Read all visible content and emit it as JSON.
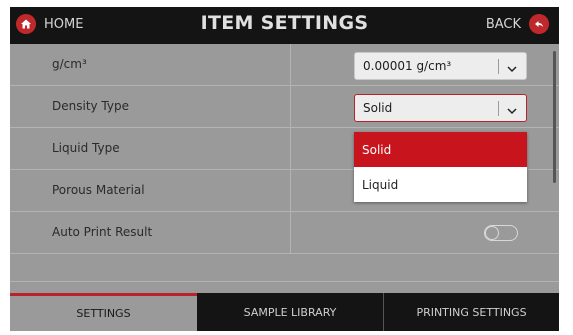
{
  "header": {
    "home_label": "HOME",
    "title": "ITEM SETTINGS",
    "back_label": "BACK"
  },
  "rows": [
    {
      "label": "g/cm³",
      "control": "select",
      "value": "0.00001 g/cm³"
    },
    {
      "label": "Density Type",
      "control": "select",
      "value": "Solid",
      "open": true
    },
    {
      "label": "Liquid Type",
      "control": "none"
    },
    {
      "label": "Porous Material",
      "control": "toggle",
      "on": false
    },
    {
      "label": "Auto Print Result",
      "control": "toggle",
      "on": false
    }
  ],
  "dropdown": {
    "options": [
      "Solid",
      "Liquid"
    ],
    "selected": "Solid"
  },
  "tabs": [
    {
      "label": "SETTINGS",
      "active": true
    },
    {
      "label": "SAMPLE LIBRARY",
      "active": false
    },
    {
      "label": "PRINTING SETTINGS",
      "active": false
    }
  ],
  "colors": {
    "accent": "#c8151d",
    "header_bg": "#141414",
    "content_bg": "#9a9a9a"
  },
  "icons": {
    "home": "home-icon",
    "back": "back-arrow-icon",
    "chevron": "chevron-down-icon"
  }
}
